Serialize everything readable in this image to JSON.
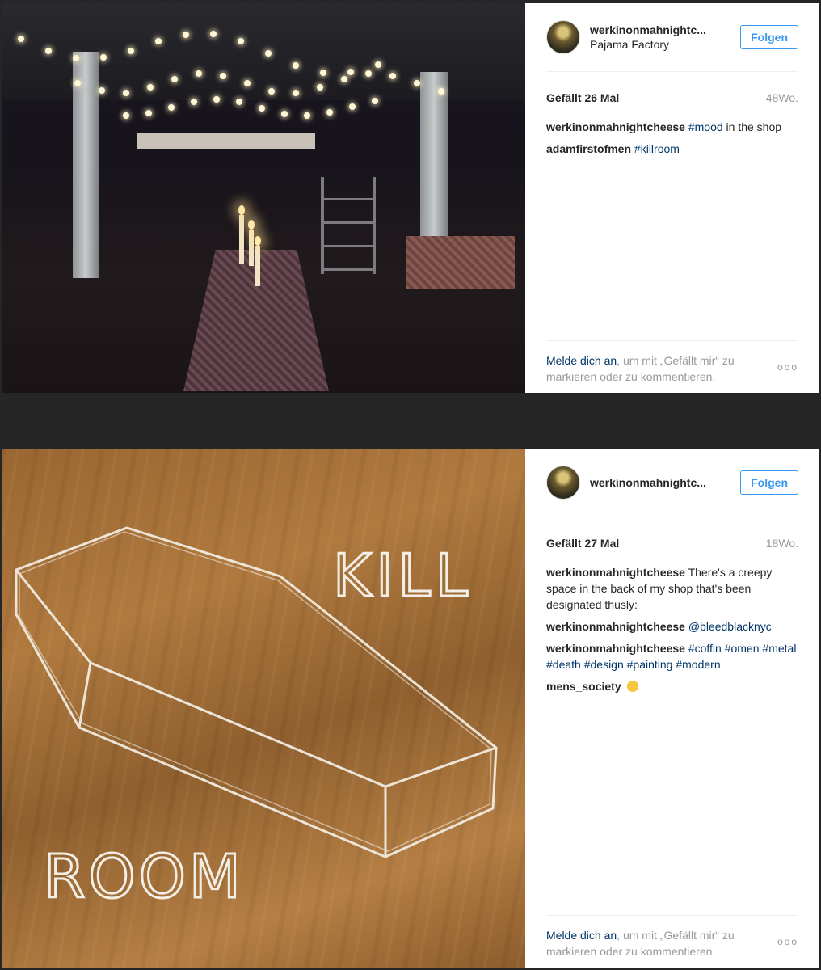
{
  "posts": [
    {
      "username": "werkinonmahnightc...",
      "location": "Pajama Factory",
      "follow_label": "Folgen",
      "likes": "Gefällt 26 Mal",
      "age": "48Wo.",
      "comments": [
        {
          "user": "werkinonmahnightcheese",
          "pre": "",
          "tag": "#mood",
          "post": " in the shop"
        },
        {
          "user": "adamfirstofmen",
          "pre": "",
          "tag": "#killroom",
          "post": ""
        }
      ],
      "login_link": "Melde dich an",
      "login_rest": ", um mit „Gefällt mir“ zu markieren oder zu kommentieren.",
      "more": "ooo"
    },
    {
      "username": "werkinonmahnightc...",
      "follow_label": "Folgen",
      "likes": "Gefällt 27 Mal",
      "age": "18Wo.",
      "comments": [
        {
          "user": "werkinonmahnightcheese",
          "text": "There's a creepy space in the back of my shop that's been designated thusly:"
        },
        {
          "user": "werkinonmahnightcheese",
          "tag": "@bleedblacknyc"
        },
        {
          "user": "werkinonmahnightcheese",
          "tag": "#coffin #omen #metal #death #design #painting #modern"
        },
        {
          "user": "mens_society"
        }
      ],
      "drawing_words": [
        "KILL",
        "ROOM"
      ],
      "login_link": "Melde dich an",
      "login_rest": ", um mit „Gefällt mir“ zu markieren oder zu kommentieren.",
      "more": "ooo"
    }
  ],
  "colors": {
    "link": "#003569",
    "follow": "#3897f0",
    "muted": "#999999",
    "text": "#262626"
  },
  "icons": [
    "avatar",
    "more-options-icon",
    "ok-hand-emoji-icon"
  ]
}
